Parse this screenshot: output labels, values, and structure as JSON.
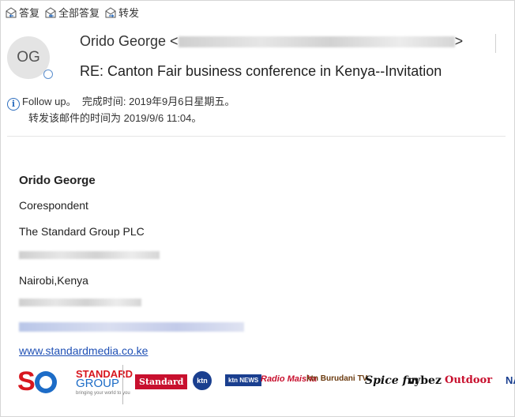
{
  "toolbar": {
    "reply": "答复",
    "reply_all": "全部答复",
    "forward": "转发"
  },
  "message": {
    "avatar_initials": "OG",
    "sender_name": "Orido George <",
    "sender_email_suffix": ">",
    "subject": "RE: Canton Fair business conference in Kenya--Invitation"
  },
  "followup": {
    "flag_text": "Follow up。",
    "completed_label": "完成时间:",
    "completed_value": "2019年9月6日星期五。",
    "forwarded_text": "转发该邮件的时间为 2019/9/6 11:04。"
  },
  "signature": {
    "name": "Orido George",
    "title": "Corespondent",
    "company": "The Standard Group PLC",
    "city": "Nairobi,Kenya",
    "website": "www.standardmedia.co.ke"
  },
  "logos": {
    "sg_mark": "SG",
    "sg_line1": "STANDARD",
    "sg_line2": "GROUP",
    "sg_tagline": "bringing your world to you",
    "brands": [
      "Standard",
      "ktn",
      "ktn NEWS",
      "Radio Maisha",
      "ktn Burudani TV",
      "Spice fm",
      "vybez",
      "Outdoor",
      "NA"
    ]
  },
  "colors": {
    "link": "#1f50b5",
    "accent_blue": "#2f6fbf",
    "brand_red": "#d8171f"
  }
}
